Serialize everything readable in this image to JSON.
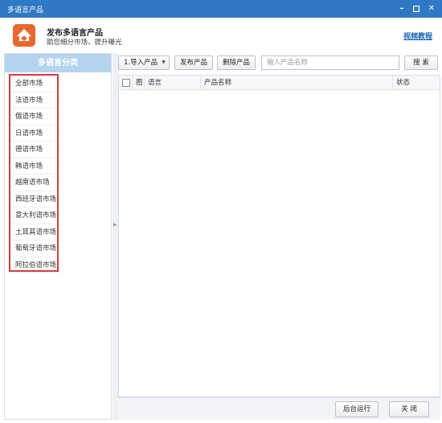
{
  "window": {
    "title": "多语言产品"
  },
  "header": {
    "title": "发布多语言产品",
    "subtitle": "助您细分市场，提升曝光",
    "help_link": "视频教程"
  },
  "sidebar": {
    "heading": "多语言分类",
    "items": [
      "全部市场",
      "法语市场",
      "俄语市场",
      "日语市场",
      "德语市场",
      "韩语市场",
      "越南语市场",
      "西班牙语市场",
      "意大利语市场",
      "土耳其语市场",
      "葡萄牙语市场",
      "阿拉伯语市场"
    ]
  },
  "toolbar": {
    "import_label": "1.导入产品",
    "publish_label": "发布产品",
    "delete_label": "删除产品",
    "search_placeholder": "输入产品名称",
    "search_label": "搜 索"
  },
  "grid": {
    "columns": [
      "图",
      "语言",
      "产品名称",
      "状态"
    ]
  },
  "footer": {
    "background_label": "后台运行",
    "close_label": "关 闭"
  },
  "colors": {
    "titlebar": "#2f78c4",
    "accent_orange": "#e8692f",
    "sidebar_heading": "#b4d4ef",
    "highlight_border": "#d63a3a",
    "link": "#1a63b5"
  }
}
